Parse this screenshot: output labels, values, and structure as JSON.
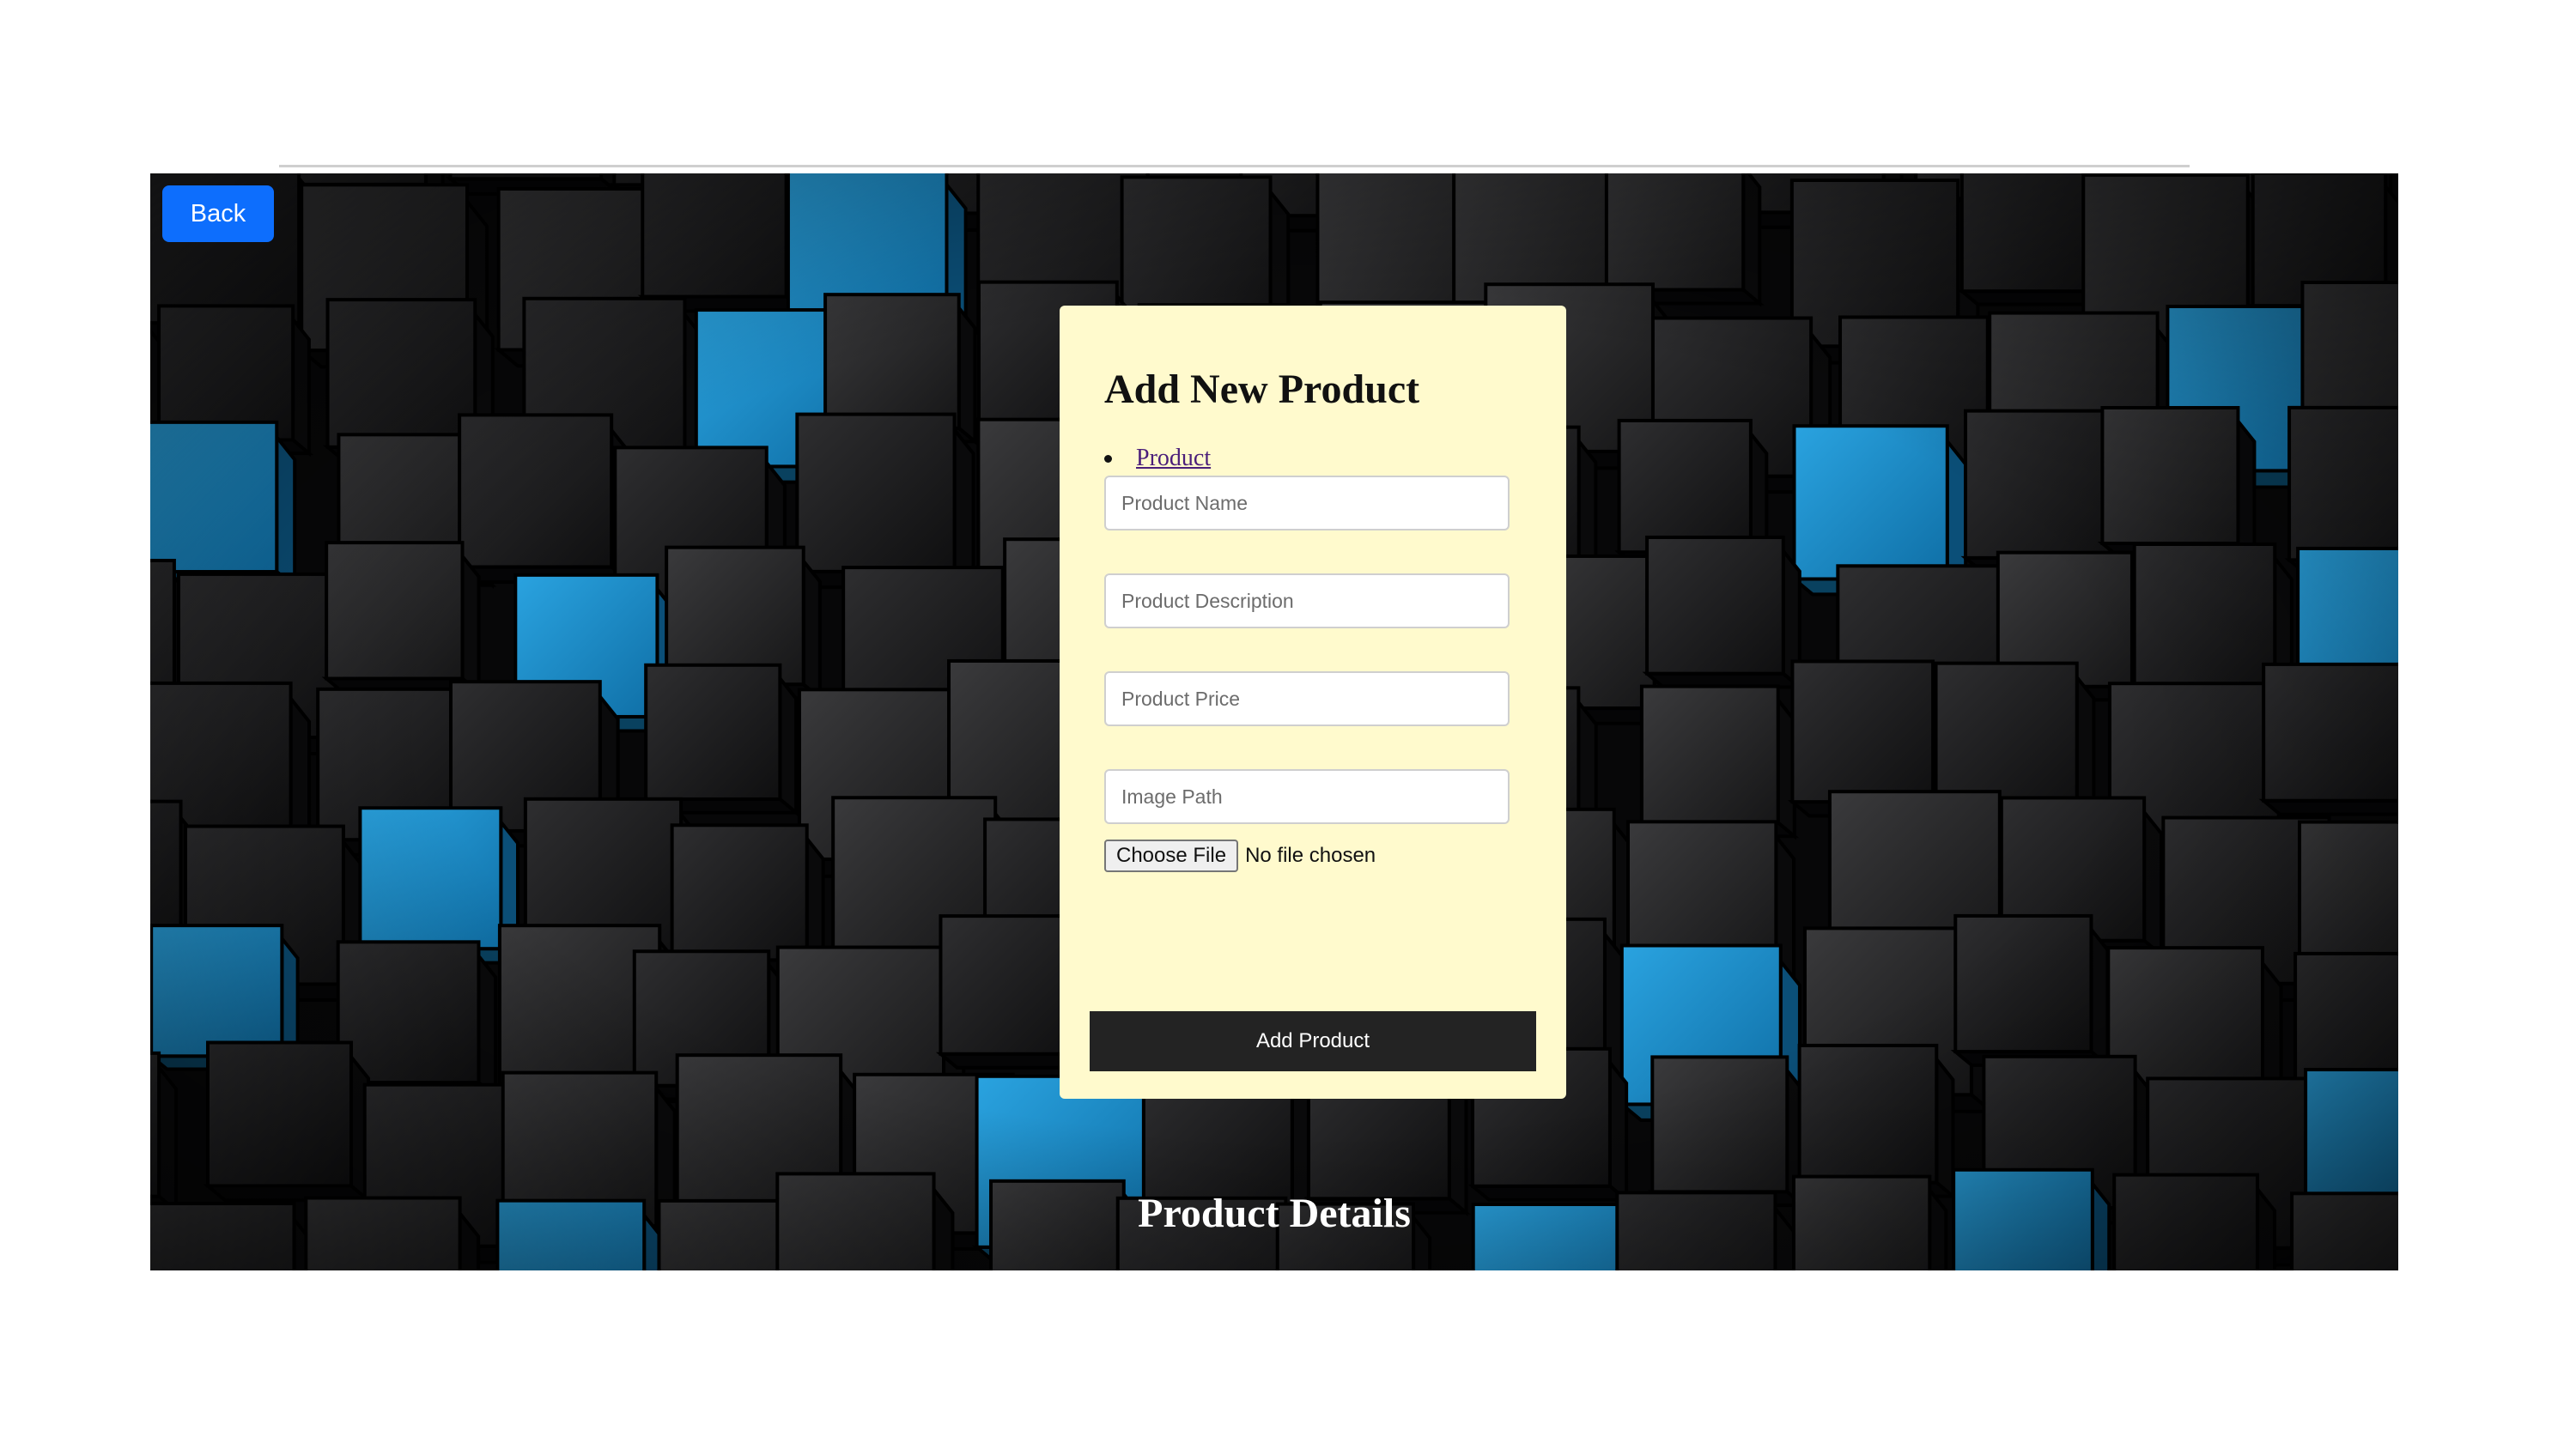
{
  "header": {
    "back_label": "Back"
  },
  "form": {
    "title": "Add New Product",
    "nav_items": [
      "Product"
    ],
    "fields": {
      "name_placeholder": "Product Name",
      "description_placeholder": "Product Description",
      "price_placeholder": "Product Price",
      "image_path_placeholder": "Image Path"
    },
    "file_input": {
      "button_label": "Choose File",
      "status": "No file chosen"
    },
    "submit_label": "Add Product"
  },
  "details": {
    "title": "Product Details"
  },
  "colors": {
    "accent_blue": "#0d6efd",
    "card_background": "#fffacd",
    "submit_background": "#232323",
    "cube_blue": "#1a8fd0"
  }
}
